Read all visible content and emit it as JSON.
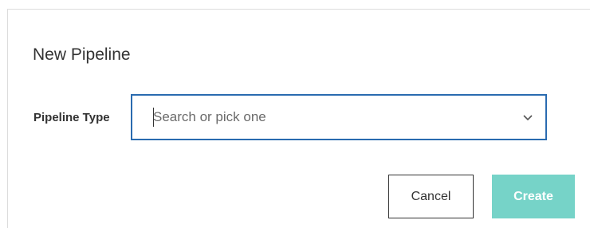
{
  "dialog": {
    "title": "New Pipeline"
  },
  "form": {
    "pipeline_type_label": "Pipeline Type",
    "pipeline_type_value": "",
    "pipeline_type_placeholder": "Search or pick one"
  },
  "actions": {
    "cancel_label": "Cancel",
    "create_label": "Create"
  },
  "icons": {
    "dropdown": "chevron-down-icon"
  },
  "colors": {
    "focus_border": "#2a6bb0",
    "create_button": "#76d3c8"
  }
}
